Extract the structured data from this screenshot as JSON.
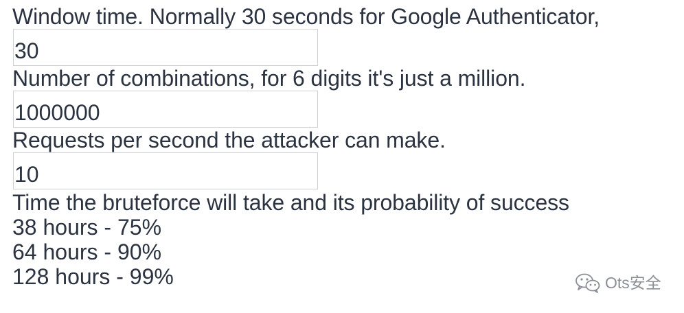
{
  "form": {
    "window_label": "Window time. Normally 30 seconds for Google Authenticator,",
    "window_value": "30",
    "combinations_label": "Number of combinations, for 6 digits it's just a million.",
    "combinations_value": "1000000",
    "requests_label": "Requests per second the attacker can make.",
    "requests_value": "10"
  },
  "results": {
    "heading": "Time the bruteforce will take and its probability of success",
    "lines": [
      "38 hours - 75%",
      "64 hours - 90%",
      "128 hours - 99%"
    ]
  },
  "watermark": {
    "icon": "wechat-icon",
    "text": "Ots安全"
  },
  "colors": {
    "text": "#2b3240",
    "field_border": "#cfd3d8",
    "watermark": "#8a8f96",
    "background": "#ffffff"
  }
}
